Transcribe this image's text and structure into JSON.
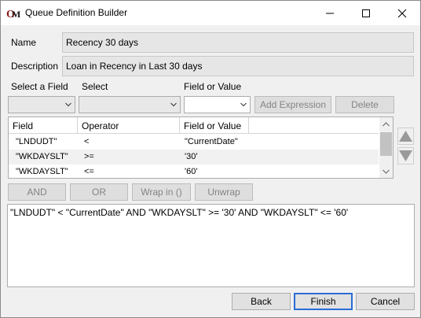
{
  "window": {
    "title": "Queue Definition Builder",
    "app_icon": "om-logo-icon",
    "controls": [
      "minimize-icon",
      "maximize-icon",
      "close-icon"
    ]
  },
  "form": {
    "name_label": "Name",
    "name_value": "Recency 30 days",
    "description_label": "Description",
    "description_value": "Loan in Recency in Last 30 days"
  },
  "builder": {
    "select_field_label": "Select a Field",
    "select_label": "Select",
    "field_or_value_label": "Field or Value",
    "add_expression_label": "Add Expression",
    "delete_label": "Delete"
  },
  "grid": {
    "columns": [
      "Field",
      "Operator",
      "Field or Value"
    ],
    "rows": [
      [
        "\"LNDUDT\"",
        "<",
        "\"CurrentDate\""
      ],
      [
        "\"WKDAYSLT\"",
        ">=",
        "'30'"
      ],
      [
        "\"WKDAYSLT\"",
        "<=",
        "'60'"
      ]
    ]
  },
  "logic_buttons": {
    "and_label": "AND",
    "or_label": "OR",
    "wrap_label": "Wrap in ()",
    "unwrap_label": "Unwrap"
  },
  "expression": "\"LNDUDT\" < \"CurrentDate\" AND \"WKDAYSLT\" >= '30' AND \"WKDAYSLT\" <= '60'",
  "footer": {
    "back_label": "Back",
    "finish_label": "Finish",
    "cancel_label": "Cancel"
  },
  "colors": {
    "default_button_border": "#2b6cd6",
    "disabled_text": "#848484",
    "readonly_field_bg": "#e6e6e6"
  }
}
